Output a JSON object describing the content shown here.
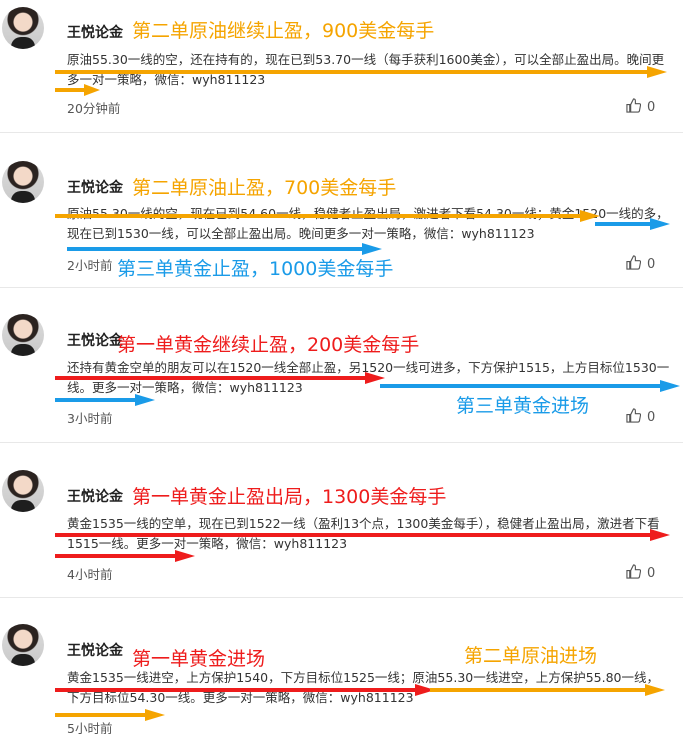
{
  "colors": {
    "orange": "#f5a400",
    "blue": "#1a9be8",
    "red": "#ee1c1c"
  },
  "posts": [
    {
      "author": "王悦论金",
      "text": "原油55.30一线的空，还在持有的，现在已到53.70一线（每手获利1600美金），可以全部止盈出局。晚间更多一对一策略，微信：wyh811123",
      "time": "20分钟前",
      "likes": "0",
      "annotations": [
        "第二单原油继续止盈，900美金每手"
      ]
    },
    {
      "author": "王悦论金",
      "text": "原油55.30一线的空，现在已到54.60一线，稳健者止盈出局，激进者下看54.30一线；黄金1520一线的多，现在已到1530一线，可以全部止盈出局。晚间更多一对一策略，微信：wyh811123",
      "time": "2小时前",
      "likes": "0",
      "annotations": [
        "第二单原油止盈，700美金每手",
        "第三单黄金止盈，1000美金每手"
      ]
    },
    {
      "author": "王悦论金",
      "text": "还持有黄金空单的朋友可以在1520一线全部止盈，另1520一线可进多，下方保护1515，上方目标位1530一线。更多一对一策略，微信：wyh811123",
      "time": "3小时前",
      "likes": "0",
      "annotations": [
        "第一单黄金继续止盈，200美金每手",
        "第三单黄金进场"
      ]
    },
    {
      "author": "王悦论金",
      "text": "黄金1535一线的空单，现在已到1522一线（盈利13个点，1300美金每手），稳健者止盈出局，激进者下看1515一线。更多一对一策略，微信：wyh811123",
      "time": "4小时前",
      "likes": "0",
      "annotations": [
        "第一单黄金止盈出局，1300美金每手"
      ]
    },
    {
      "author": "王悦论金",
      "text": "黄金1535一线进空，上方保护1540，下方目标位1525一线；原油55.30一线进空，上方保护55.80一线，下方目标位54.30一线。更多一对一策略，微信：wyh811123",
      "time": "5小时前",
      "likes": "0",
      "annotations": [
        "第一单黄金进场",
        "第二单原油进场"
      ]
    }
  ]
}
